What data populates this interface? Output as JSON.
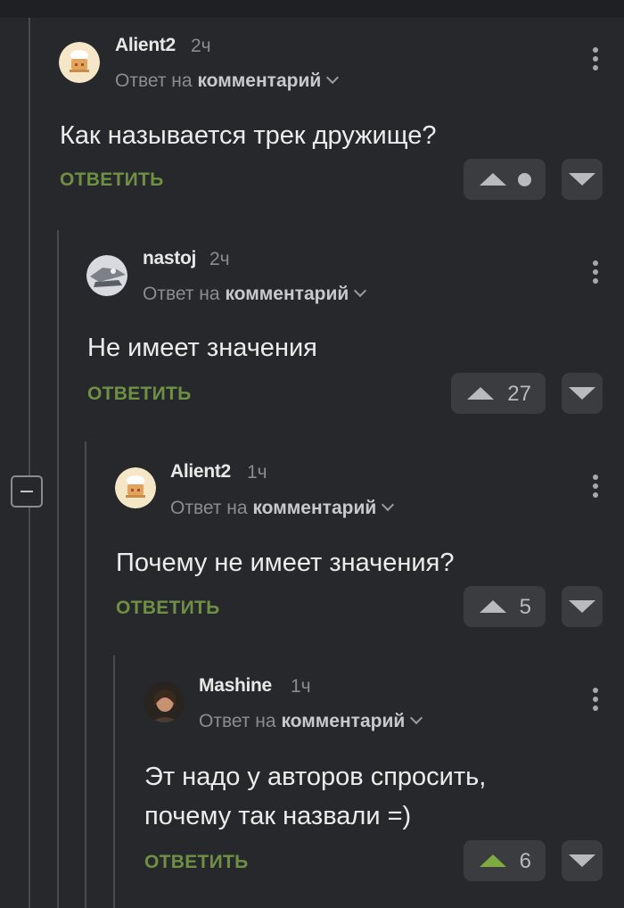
{
  "comments": [
    {
      "username": "Alient2",
      "time": "2ч",
      "reply_prefix": "Ответ на",
      "reply_target": "комментарий",
      "text": "Как называется трек дружище?",
      "reply_label": "ОТВЕТИТЬ",
      "rating": "",
      "avatar": "chef-avatar"
    },
    {
      "username": "nastoj",
      "time": "2ч",
      "reply_prefix": "Ответ на",
      "reply_target": "комментарий",
      "text": "Не имеет значения",
      "reply_label": "ОТВЕТИТЬ",
      "rating": "27",
      "avatar": "photo-avatar"
    },
    {
      "username": "Alient2",
      "time": "1ч",
      "reply_prefix": "Ответ на",
      "reply_target": "комментарий",
      "text": "Почему не имеет значения?",
      "reply_label": "ОТВЕТИТЬ",
      "rating": "5",
      "avatar": "chef-avatar"
    },
    {
      "username": "Mashine",
      "time": "1ч",
      "reply_prefix": "Ответ на",
      "reply_target": "комментарий",
      "text_lines": [
        "Эт надо у авторов спросить,",
        "почему так назвали =)"
      ],
      "reply_label": "ОТВЕТИТЬ",
      "rating": "6",
      "upvoted": true,
      "avatar": "photo-avatar"
    }
  ],
  "colors": {
    "background": "#27282b",
    "reply_green": "#6f8f44",
    "upvote_active": "#7eaa3f"
  }
}
